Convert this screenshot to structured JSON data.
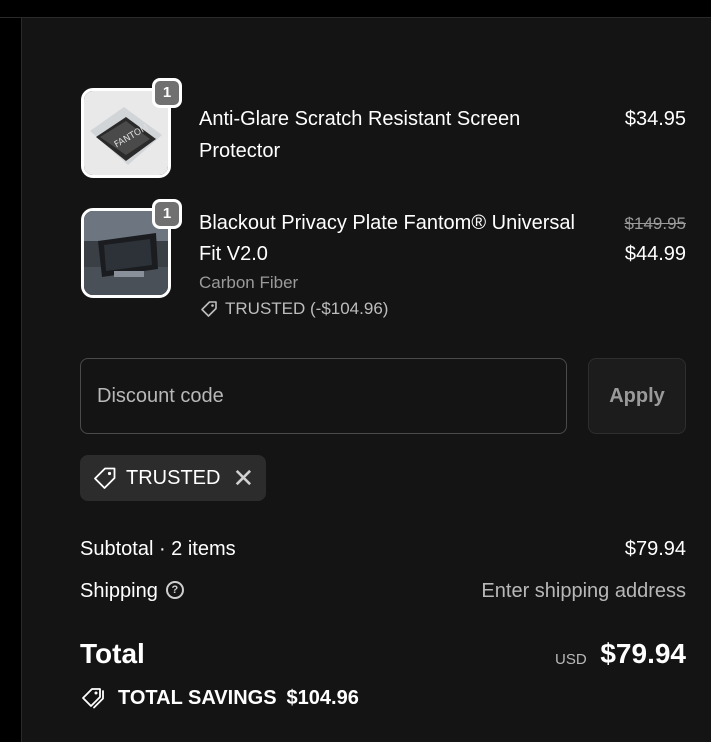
{
  "line_items": [
    {
      "quantity": "1",
      "name_line1": "Anti-Glare Scratch Resistant Screen",
      "name_line2": "Protector",
      "price": "$34.95"
    },
    {
      "quantity": "1",
      "name_line1": "Blackout Privacy Plate Fantom® Universal",
      "name_line2": "Fit V2.0",
      "original_price": "$149.95",
      "price": "$44.99",
      "variant": "Carbon Fiber",
      "discount": "TRUSTED (-$104.96)"
    }
  ],
  "discount": {
    "placeholder": "Discount code",
    "apply_label": "Apply",
    "applied_code": "TRUSTED"
  },
  "summary": {
    "subtotal_label": "Subtotal · 2 items",
    "subtotal_value": "$79.94",
    "shipping_label": "Shipping",
    "shipping_value": "Enter shipping address",
    "total_label": "Total",
    "currency": "USD",
    "total_value": "$79.94",
    "savings_label": "TOTAL SAVINGS",
    "savings_value": "$104.96"
  },
  "icons": {
    "help": "question-circle-icon",
    "tag": "tag-icon",
    "close": "close-icon",
    "savings": "tags-icon"
  },
  "colors": {
    "panel_bg": "#141414",
    "chip_bg": "#2c2c2c",
    "muted_text": "#b8b8b8",
    "badge_bg": "#707070"
  }
}
